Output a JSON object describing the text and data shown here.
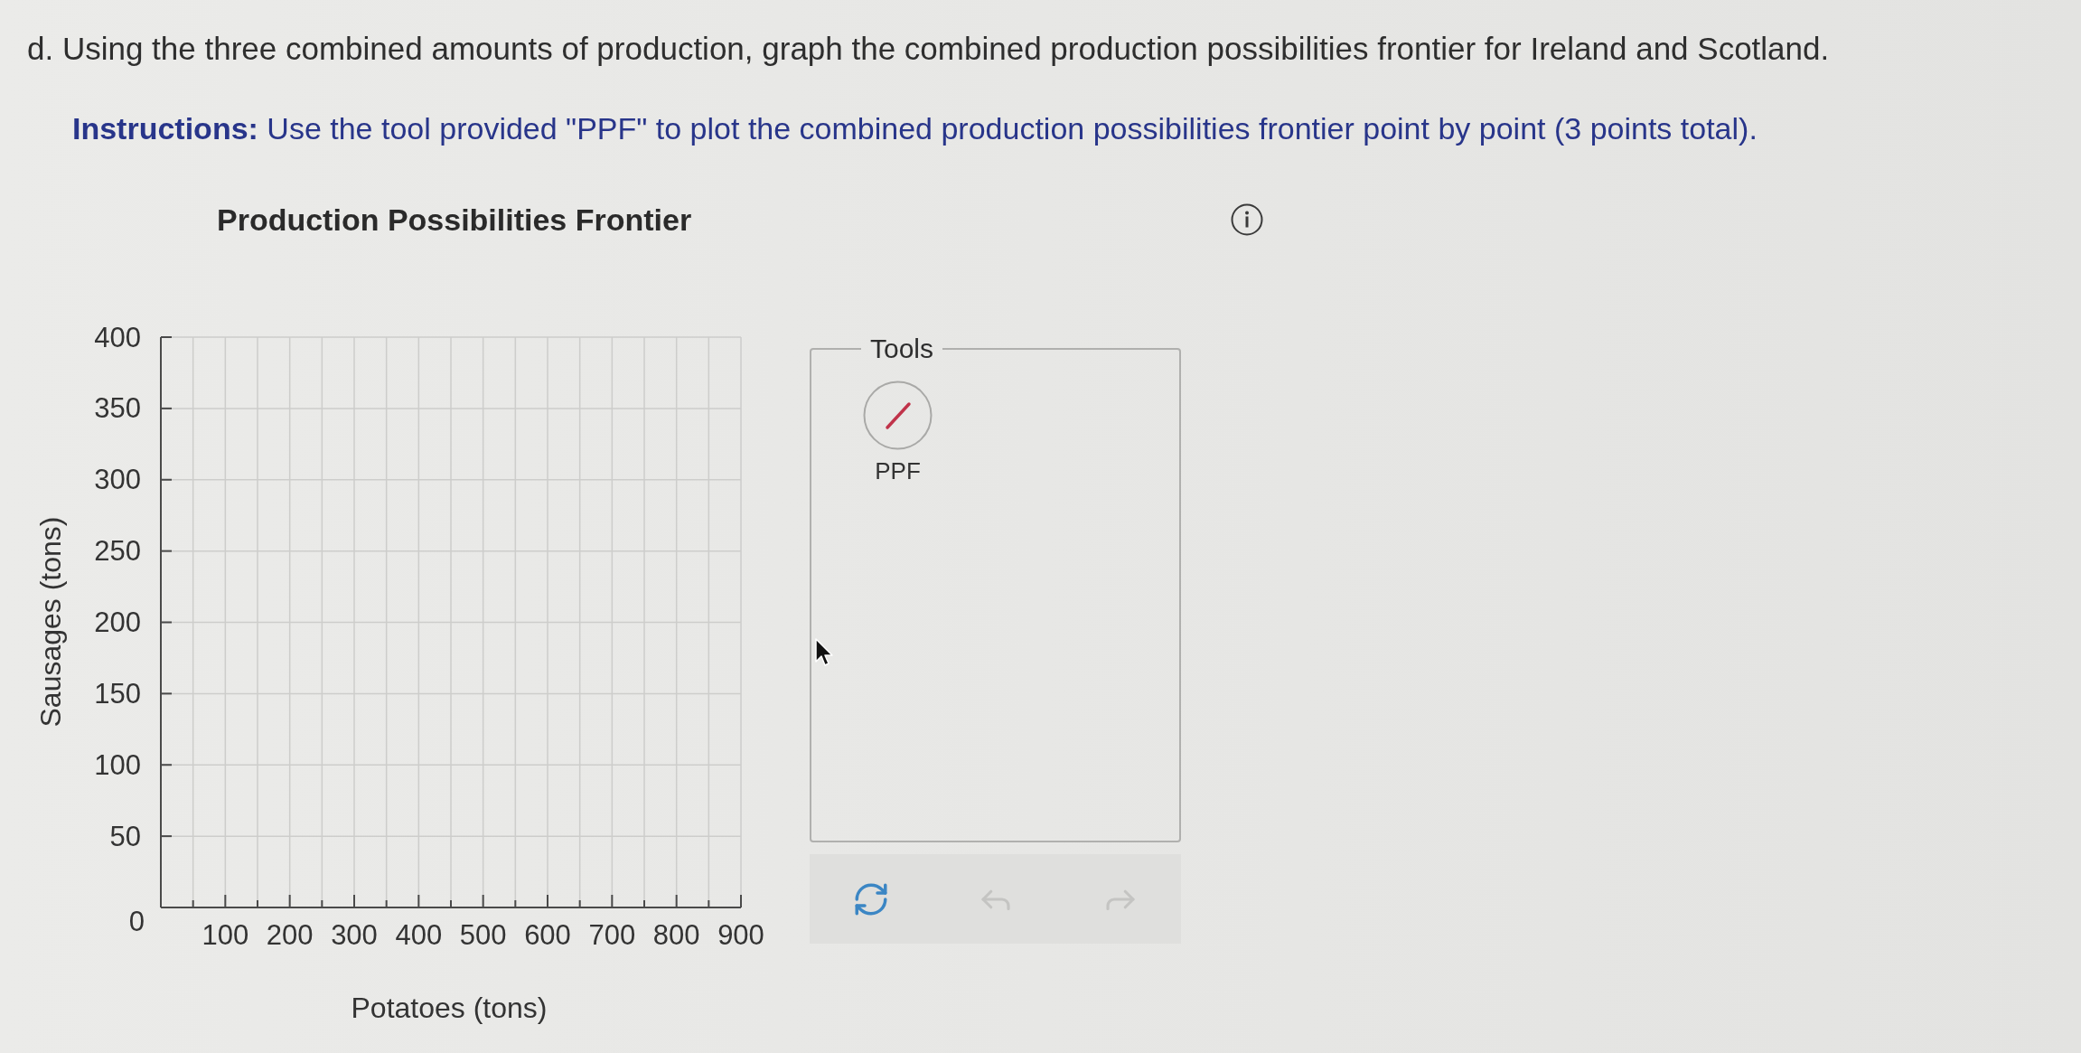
{
  "question": {
    "text": "d. Using the three combined amounts of production, graph the combined production possibilities frontier for Ireland and Scotland."
  },
  "instructions": "**Instructions:** Use the tool provided \"PPF\" to plot the combined production possibilities frontier point by point (3 points total).",
  "graph": {
    "chart_data": {
      "type": "line",
      "title": "Production Possibilities Frontier",
      "xlabel": "Potatoes (tons)",
      "ylabel": "Sausages (tons)",
      "xlim": [
        0,
        900
      ],
      "ylim": [
        0,
        400
      ],
      "xticks": [
        100,
        200,
        300,
        400,
        500,
        600,
        700,
        800,
        900
      ],
      "yticks": [
        0,
        50,
        100,
        150,
        200,
        250,
        300,
        350,
        400
      ],
      "grid": true
    }
  },
  "tools_panel": {
    "title": "Tools",
    "tools": [
      {
        "label": "PPF"
      }
    ]
  },
  "toolbar": [
    {
      "kind": "reset",
      "disabled": false
    },
    {
      "kind": "undo",
      "disabled": true
    },
    {
      "kind": "redo",
      "disabled": true
    }
  ]
}
